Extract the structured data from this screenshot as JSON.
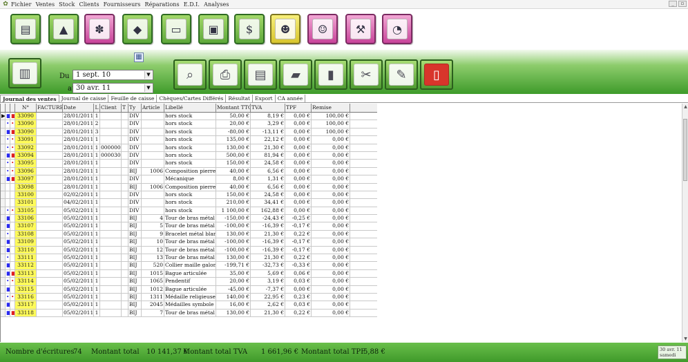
{
  "menubar": {
    "items": [
      "Fichier",
      "Ventes",
      "Stock",
      "Clients",
      "Fournisseurs",
      "Réparations",
      "E.D.I.",
      "Analyses"
    ]
  },
  "modules": [
    {
      "icon": "cash-register-icon",
      "color": "green"
    },
    {
      "icon": "pyramid-icon",
      "color": "green"
    },
    {
      "icon": "gift-shopping-icon",
      "color": "pink"
    },
    {
      "icon": "diamond-icon",
      "color": "green"
    },
    {
      "icon": "document-icon",
      "color": "green"
    },
    {
      "icon": "safe-icon",
      "color": "green"
    },
    {
      "icon": "money-icon",
      "color": "green"
    },
    {
      "icon": "supplier-people-icon",
      "color": "yellow"
    },
    {
      "icon": "customers-people-icon",
      "color": "pink"
    },
    {
      "icon": "repair-tools-icon",
      "color": "pink"
    },
    {
      "icon": "analysis-chart-icon",
      "color": "pink"
    }
  ],
  "filter": {
    "from_label": "Du",
    "to_label": "au",
    "from_value": "1 sept. 10",
    "to_value": "30 avr. 11"
  },
  "tabs": [
    "Journal des ventes",
    "Journal de caisse",
    "Feuille de caisse",
    "Chèques/Cartes Différés",
    "Résultat",
    "Export",
    "CA année"
  ],
  "grid": {
    "headers": [
      "",
      "",
      "",
      "N°",
      "FACTURE",
      "Date",
      "L",
      "Client",
      "T",
      "Ty",
      "Article",
      "Libellé",
      "Montant TTC",
      "TVA",
      "TPF",
      "Remise"
    ],
    "rows": [
      {
        "a": "■",
        "b": "■",
        "num": "33090",
        "fac": "",
        "date": "28/01/2011",
        "l": "1",
        "client": "",
        "t": "",
        "type": "DIV",
        "article": "",
        "lib": "hors stock",
        "mt": "50,00 €",
        "tva": "8,19 €",
        "tpf": "0,00 €",
        "rem": "100,00 €",
        "sel": "▶"
      },
      {
        "a": "•",
        "b": "•",
        "num": "33090",
        "fac": "",
        "date": "28/01/2011",
        "l": "2",
        "client": "",
        "t": "",
        "type": "DIV",
        "article": "",
        "lib": "hors stock",
        "mt": "20,00 €",
        "tva": "3,29 €",
        "tpf": "0,00 €",
        "rem": "100,00 €",
        "sel": ""
      },
      {
        "a": "■",
        "b": "■",
        "num": "33090",
        "fac": "",
        "date": "28/01/2011",
        "l": "3",
        "client": "",
        "t": "",
        "type": "DIV",
        "article": "",
        "lib": "hors stock",
        "mt": "-80,00 €",
        "tva": "-13,11 €",
        "tpf": "0,00 €",
        "rem": "100,00 €",
        "sel": ""
      },
      {
        "a": "•",
        "b": "•",
        "num": "33091",
        "fac": "",
        "date": "28/01/2011",
        "l": "1",
        "client": "",
        "t": "",
        "type": "DIV",
        "article": "",
        "lib": "hors stock",
        "mt": "135,00 €",
        "tva": "22,12 €",
        "tpf": "0,00 €",
        "rem": "0,00 €",
        "sel": ""
      },
      {
        "a": "•",
        "b": "•",
        "num": "33092",
        "fac": "",
        "date": "28/01/2011",
        "l": "1",
        "client": "000000",
        "t": "",
        "type": "DIV",
        "article": "",
        "lib": "hors stock",
        "mt": "130,00 €",
        "tva": "21,30 €",
        "tpf": "0,00 €",
        "rem": "0,00 €",
        "sel": ""
      },
      {
        "a": "■",
        "b": "■",
        "num": "33094",
        "fac": "",
        "date": "28/01/2011",
        "l": "1",
        "client": "000030",
        "t": "",
        "type": "DIV",
        "article": "",
        "lib": "hors stock",
        "mt": "500,00 €",
        "tva": "81,94 €",
        "tpf": "0,00 €",
        "rem": "0,00 €",
        "sel": ""
      },
      {
        "a": "•",
        "b": "•",
        "num": "33095",
        "fac": "",
        "date": "28/01/2011",
        "l": "1",
        "client": "",
        "t": "",
        "type": "DIV",
        "article": "",
        "lib": "hors stock",
        "mt": "150,00 €",
        "tva": "24,58 €",
        "tpf": "0,00 €",
        "rem": "0,00 €",
        "sel": ""
      },
      {
        "a": "•",
        "b": "•",
        "num": "33096",
        "fac": "",
        "date": "28/01/2011",
        "l": "1",
        "client": "",
        "t": "",
        "type": "BIJ",
        "article": "1006",
        "lib": "Composition pierre",
        "mt": "40,00 €",
        "tva": "6,56 €",
        "tpf": "0,00 €",
        "rem": "0,00 €",
        "sel": ""
      },
      {
        "a": "■",
        "b": "■",
        "num": "33097",
        "fac": "",
        "date": "28/01/2011",
        "l": "1",
        "client": "",
        "t": "",
        "type": "DIV",
        "article": "",
        "lib": "Mécanique",
        "mt": "8,00 €",
        "tva": "1,31 €",
        "tpf": "0,00 €",
        "rem": "0,00 €",
        "sel": ""
      },
      {
        "a": "",
        "b": "",
        "num": "33098",
        "fac": "",
        "date": "28/01/2011",
        "l": "1",
        "client": "",
        "t": "",
        "type": "BIJ",
        "article": "1006",
        "lib": "Composition pierre",
        "mt": "40,00 €",
        "tva": "6,56 €",
        "tpf": "0,00 €",
        "rem": "0,00 €",
        "sel": ""
      },
      {
        "a": "",
        "b": "",
        "num": "33100",
        "fac": "",
        "date": "02/02/2011",
        "l": "1",
        "client": "",
        "t": "",
        "type": "DIV",
        "article": "",
        "lib": "hors stock",
        "mt": "150,00 €",
        "tva": "24,58 €",
        "tpf": "0,00 €",
        "rem": "0,00 €",
        "sel": ""
      },
      {
        "a": "",
        "b": "",
        "num": "33101",
        "fac": "",
        "date": "04/02/2011",
        "l": "1",
        "client": "",
        "t": "",
        "type": "DIV",
        "article": "",
        "lib": "hors stock",
        "mt": "210,00 €",
        "tva": "34,41 €",
        "tpf": "0,00 €",
        "rem": "0,00 €",
        "sel": ""
      },
      {
        "a": "•",
        "b": "•",
        "num": "33105",
        "fac": "",
        "date": "05/02/2011",
        "l": "1",
        "client": "",
        "t": "",
        "type": "DIV",
        "article": "",
        "lib": "hors stock",
        "mt": "1 100,00 €",
        "tva": "162,88 €",
        "tpf": "0,00 €",
        "rem": "0,00 €",
        "sel": ""
      },
      {
        "a": "■",
        "b": "",
        "num": "33106",
        "fac": "",
        "date": "05/02/2011",
        "l": "1",
        "client": "",
        "t": "",
        "type": "BIJ",
        "article": "4",
        "lib": "Tour de bras métal",
        "mt": "-150,00 €",
        "tva": "-24,43 €",
        "tpf": "-0,25 €",
        "rem": "0,00 €",
        "sel": ""
      },
      {
        "a": "■",
        "b": "",
        "num": "33107",
        "fac": "",
        "date": "05/02/2011",
        "l": "1",
        "client": "",
        "t": "",
        "type": "BIJ",
        "article": "5",
        "lib": "Tour de bras métal",
        "mt": "-100,00 €",
        "tva": "-16,39 €",
        "tpf": "-0,17 €",
        "rem": "0,00 €",
        "sel": ""
      },
      {
        "a": "•",
        "b": "",
        "num": "33108",
        "fac": "",
        "date": "05/02/2011",
        "l": "1",
        "client": "",
        "t": "",
        "type": "BIJ",
        "article": "9",
        "lib": "Bracelet métal blanc, bo",
        "mt": "130,00 €",
        "tva": "21,30 €",
        "tpf": "0,22 €",
        "rem": "0,00 €",
        "sel": ""
      },
      {
        "a": "■",
        "b": "",
        "num": "33109",
        "fac": "",
        "date": "05/02/2011",
        "l": "1",
        "client": "",
        "t": "",
        "type": "BIJ",
        "article": "10",
        "lib": "Tour de bras métal",
        "mt": "-100,00 €",
        "tva": "-16,39 €",
        "tpf": "-0,17 €",
        "rem": "0,00 €",
        "sel": ""
      },
      {
        "a": "■",
        "b": "",
        "num": "33110",
        "fac": "",
        "date": "05/02/2011",
        "l": "1",
        "client": "",
        "t": "",
        "type": "BIJ",
        "article": "12",
        "lib": "Tour de bras métal",
        "mt": "-100,00 €",
        "tva": "-16,39 €",
        "tpf": "-0,17 €",
        "rem": "0,00 €",
        "sel": ""
      },
      {
        "a": "•",
        "b": "",
        "num": "33111",
        "fac": "",
        "date": "05/02/2011",
        "l": "1",
        "client": "",
        "t": "",
        "type": "BIJ",
        "article": "13",
        "lib": "Tour de bras métal",
        "mt": "130,00 €",
        "tva": "21,30 €",
        "tpf": "0,22 €",
        "rem": "0,00 €",
        "sel": ""
      },
      {
        "a": "■",
        "b": "",
        "num": "33112",
        "fac": "",
        "date": "05/02/2011",
        "l": "1",
        "client": "",
        "t": "",
        "type": "BIJ",
        "article": "520",
        "lib": "Collier maille galon",
        "mt": "-199,71 €",
        "tva": "-32,73 €",
        "tpf": "-0,33 €",
        "rem": "0,00 €",
        "sel": ""
      },
      {
        "a": "■",
        "b": "■",
        "num": "33113",
        "fac": "",
        "date": "05/02/2011",
        "l": "1",
        "client": "",
        "t": "",
        "type": "BIJ",
        "article": "1015",
        "lib": "Bague articulée",
        "mt": "35,00 €",
        "tva": "5,69 €",
        "tpf": "0,06 €",
        "rem": "0,00 €",
        "sel": ""
      },
      {
        "a": "•",
        "b": "•",
        "num": "33114",
        "fac": "",
        "date": "05/02/2011",
        "l": "1",
        "client": "",
        "t": "",
        "type": "BIJ",
        "article": "1065",
        "lib": "Pendentif",
        "mt": "20,00 €",
        "tva": "3,19 €",
        "tpf": "0,03 €",
        "rem": "0,00 €",
        "sel": ""
      },
      {
        "a": "■",
        "b": "",
        "num": "33115",
        "fac": "",
        "date": "05/02/2011",
        "l": "1",
        "client": "",
        "t": "",
        "type": "BIJ",
        "article": "1012",
        "lib": "Bague articulée",
        "mt": "-45,00 €",
        "tva": "-7,37 €",
        "tpf": "0,00 €",
        "rem": "0,00 €",
        "sel": ""
      },
      {
        "a": "•",
        "b": "•",
        "num": "33116",
        "fac": "",
        "date": "05/02/2011",
        "l": "1",
        "client": "",
        "t": "",
        "type": "BIJ",
        "article": "1311",
        "lib": "Médaille religieuse",
        "mt": "140,00 €",
        "tva": "22,95 €",
        "tpf": "0,23 €",
        "rem": "0,00 €",
        "sel": ""
      },
      {
        "a": "■",
        "b": "",
        "num": "33117",
        "fac": "",
        "date": "05/02/2011",
        "l": "1",
        "client": "",
        "t": "",
        "type": "BIJ",
        "article": "2045",
        "lib": "Médailles symbole",
        "mt": "16,00 €",
        "tva": "2,62 €",
        "tpf": "0,03 €",
        "rem": "0,00 €",
        "sel": ""
      },
      {
        "a": "■",
        "b": "■",
        "num": "33118",
        "fac": "",
        "date": "05/02/2011",
        "l": "1",
        "client": "",
        "t": "",
        "type": "BIJ",
        "article": "7",
        "lib": "Tour de bras métal",
        "mt": "130,00 €",
        "tva": "21,30 €",
        "tpf": "0,22 €",
        "rem": "0,00 €",
        "sel": ""
      }
    ]
  },
  "footer": {
    "count_label": "Nombre d'écritures",
    "count_value": "74",
    "total_label": "Montant total",
    "total_value": "10 141,37 €",
    "tva_label": "Montant total TVA",
    "tva_value": "1 661,96 €",
    "tpf_label": "Montant total TPF",
    "tpf_value": "5,88 €",
    "clock_date": "30 avr. 11",
    "clock_day": "samedi"
  }
}
